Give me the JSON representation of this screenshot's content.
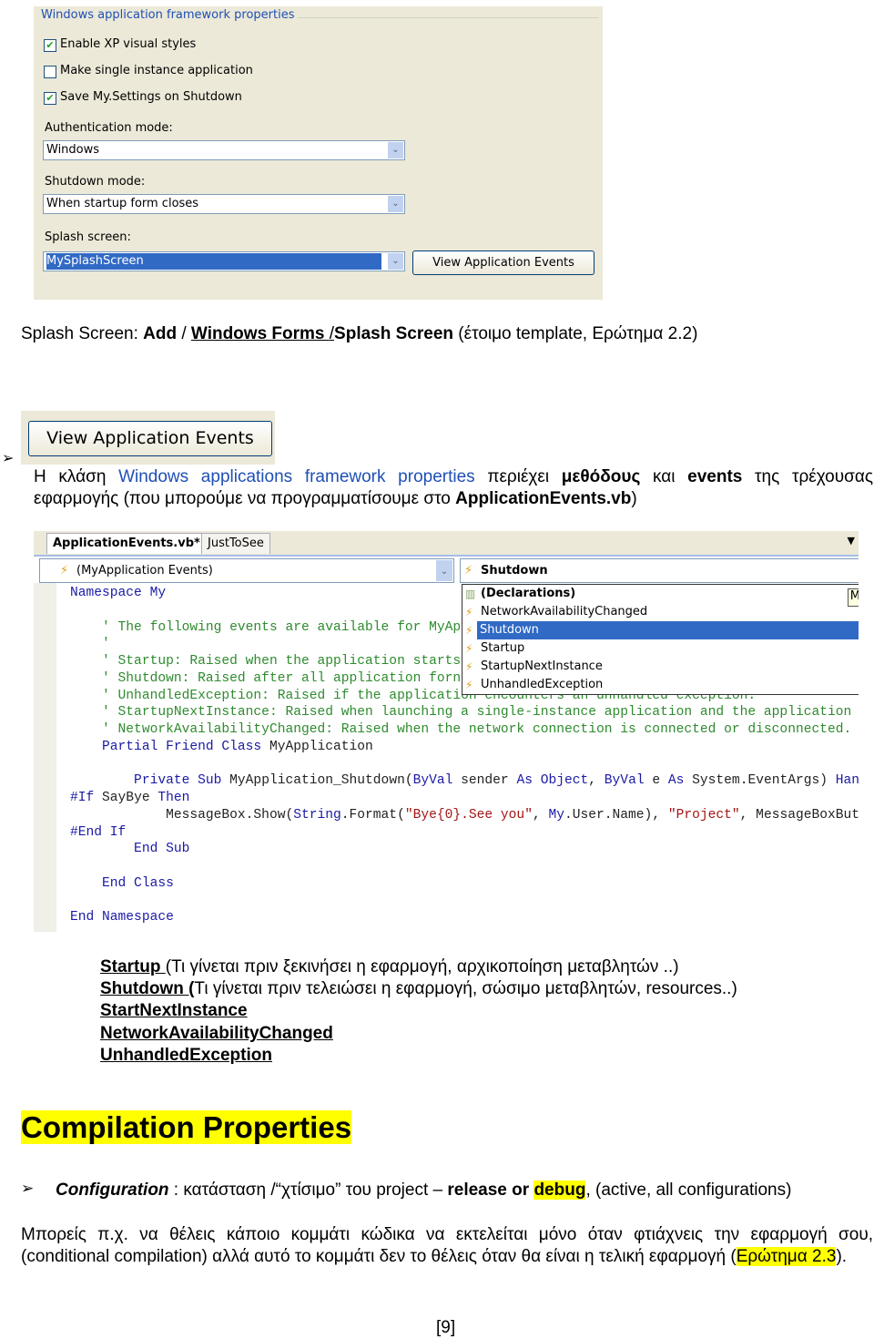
{
  "panel": {
    "group_title": "Windows application framework properties",
    "checkboxes": [
      {
        "label": "Enable XP visual styles",
        "checked": true
      },
      {
        "label": "Make single instance application",
        "checked": false
      },
      {
        "label": "Save My.Settings on Shutdown",
        "checked": true
      }
    ],
    "auth_label": "Authentication mode:",
    "auth_value": "Windows",
    "shutdown_label": "Shutdown mode:",
    "shutdown_value": "When startup form closes",
    "splash_label": "Splash screen:",
    "splash_value": "MySplashScreen",
    "view_events_button": "View Application Events",
    "check_mark": "✔",
    "arrow": "⌄"
  },
  "splash_para": {
    "prefix": "Splash Screen: ",
    "add": "Add",
    "sep1": " / ",
    "wf": "Windows Forms ",
    "sep2": "/",
    "ss": "Splash Screen",
    "suffix": " (έτοιμο template, Ερώτημα 2.2)"
  },
  "button_image": {
    "label": "View Application Events"
  },
  "para2": {
    "bullet": "➢",
    "t1": "Η κλάση ",
    "t2": "Windows applications framework properties",
    "t3": " περιέχει ",
    "t4": "μεθόδους",
    "t5": " και ",
    "t6": "events",
    "t7": " της τρέχουσας εφαρμογής (που μπορούμε να προγραμματίσουμε στο ",
    "t8": "ApplicationEvents.vb",
    "t9": ")"
  },
  "editor": {
    "tabs": [
      "ApplicationEvents.vb*",
      "JustToSee"
    ],
    "left_combo": "(MyApplication Events)",
    "right_combo": "Shutdown",
    "dropdown": [
      "(Declarations)",
      "NetworkAvailabilityChanged",
      "Shutdown",
      "Startup",
      "StartupNextInstance",
      "UnhandledException"
    ],
    "dropdown_selected": "Shutdown",
    "tooltip": "M",
    "lines": [
      [
        [
          "kw",
          "Namespace"
        ],
        [
          "pl",
          " "
        ],
        [
          "kw",
          "My"
        ]
      ],
      [],
      [
        [
          "cm",
          "    ' The following events are available for MyAp"
        ]
      ],
      [
        [
          "cm",
          "    '"
        ]
      ],
      [
        [
          "cm",
          "    ' Startup: Raised when the application starts"
        ]
      ],
      [
        [
          "cm",
          "    ' Shutdown: Raised after all application forn"
        ]
      ],
      [
        [
          "cm",
          "    ' UnhandledException: Raised if the application encounters an unhandled exception."
        ]
      ],
      [
        [
          "cm",
          "    ' StartupNextInstance: Raised when launching a single-instance application and the application"
        ]
      ],
      [
        [
          "cm",
          "    ' NetworkAvailabilityChanged: Raised when the network connection is connected or disconnected."
        ]
      ],
      [
        [
          "kw",
          "    Partial Friend Class"
        ],
        [
          "pl",
          " MyApplication"
        ]
      ],
      [],
      [
        [
          "kw",
          "        Private Sub"
        ],
        [
          "pl",
          " MyApplication_Shutdown("
        ],
        [
          "kw",
          "ByVal"
        ],
        [
          "pl",
          " sender "
        ],
        [
          "kw",
          "As Object"
        ],
        [
          "pl",
          ", "
        ],
        [
          "kw",
          "ByVal"
        ],
        [
          "pl",
          " e "
        ],
        [
          "kw",
          "As"
        ],
        [
          "pl",
          " System.EventArgs) "
        ],
        [
          "kw",
          "Handles"
        ]
      ],
      [
        [
          "kw",
          "#If"
        ],
        [
          "pl",
          " SayBye "
        ],
        [
          "kw",
          "Then"
        ]
      ],
      [
        [
          "pl",
          "            MessageBox.Show("
        ],
        [
          "kw",
          "String"
        ],
        [
          "pl",
          ".Format("
        ],
        [
          "st",
          "\"Bye{0}.See you\""
        ],
        [
          "pl",
          ", "
        ],
        [
          "kw",
          "My"
        ],
        [
          "pl",
          ".User.Name), "
        ],
        [
          "st",
          "\"Project\""
        ],
        [
          "pl",
          ", MessageBoxButtons"
        ]
      ],
      [
        [
          "kw",
          "#End If"
        ]
      ],
      [
        [
          "kw",
          "        End Sub"
        ]
      ],
      [],
      [
        [
          "kw",
          "    End Class"
        ]
      ],
      [],
      [
        [
          "kw",
          "End Namespace"
        ]
      ]
    ]
  },
  "events_list": [
    {
      "name": "Startup ",
      "desc": "(Τι γίνεται πριν ξεκινήσει η εφαρμογή, αρχικοποίηση μεταβλητών ..)"
    },
    {
      "name": "Shutdown (",
      "desc": "Τι γίνεται πριν τελειώσει η εφαρμογή, σώσιμο μεταβλητών, resources..)"
    },
    {
      "name": "StartNextInstance",
      "desc": ""
    },
    {
      "name": "NetworkAvailabilityChanged",
      "desc": ""
    },
    {
      "name": "UnhandledException",
      "desc": ""
    }
  ],
  "heading": "Compilation Properties",
  "config": {
    "bullet": "➢",
    "label": "Configuration",
    "t1": " : κατάσταση /“χτίσιμο” του project – ",
    "t2": "release or ",
    "t3": "debug",
    "t4": ", (active, all configurations)"
  },
  "para3": {
    "t1": "Μπορείς π.χ. να θέλεις κάποιο κομμάτι κώδικα να εκτελείται μόνο όταν φτιάχνεις  την εφαρμογή σου, (conditional compilation) αλλά  αυτό το κομμάτι δεν το θέλεις όταν θα είναι η τελική εφαρμογή (",
    "t2": "Ερώτημα 2.3",
    "t3": ")."
  },
  "page_number": "[9]",
  "colors": {
    "highlight": "#ffff00",
    "selection": "#316ac5",
    "link_blue": "#1f4fb5"
  }
}
